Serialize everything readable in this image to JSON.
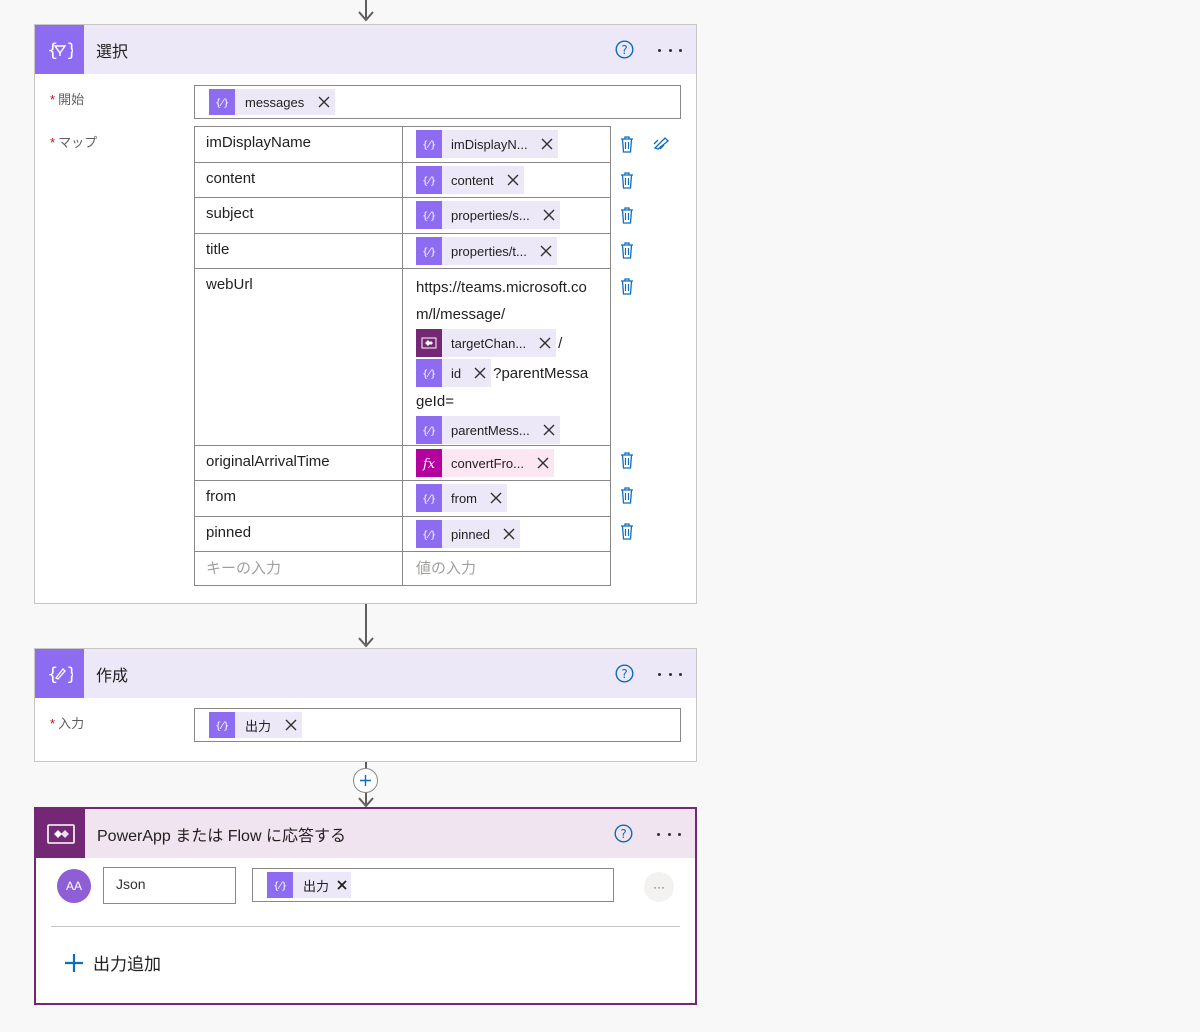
{
  "select_action": {
    "title": "選択",
    "from_label": "開始",
    "map_label": "マップ",
    "from_token": "messages",
    "rows": [
      {
        "key": "imDisplayName",
        "token": "imDisplayN..."
      },
      {
        "key": "content",
        "token": "content"
      },
      {
        "key": "subject",
        "token": "properties/s..."
      },
      {
        "key": "title",
        "token": "properties/t..."
      },
      {
        "key": "webUrl",
        "text1": "https://teams.microsoft.co",
        "text2": "m/l/message/",
        "token1": "targetChan...",
        "sep": "/",
        "token2": "id",
        "text3": "?parentMessa",
        "text4": "geId=",
        "token3": "parentMess..."
      },
      {
        "key": "originalArrivalTime",
        "token": "convertFro..."
      },
      {
        "key": "from",
        "token": "from"
      },
      {
        "key": "pinned",
        "token": "pinned"
      }
    ],
    "key_placeholder": "キーの入力",
    "value_placeholder": "値の入力"
  },
  "compose_action": {
    "title": "作成",
    "input_label": "入力",
    "token": "出力"
  },
  "respond_action": {
    "title": "PowerApp または Flow に応答する",
    "avatar_text": "AA",
    "name_value": "Json",
    "token": "出力",
    "add_output_label": "出力追加"
  },
  "colors": {
    "accent_purple": "#8e6cf2",
    "powerapps_purple": "#742774",
    "expression_pink": "#b4009e",
    "link_blue": "#0f6cbd"
  }
}
